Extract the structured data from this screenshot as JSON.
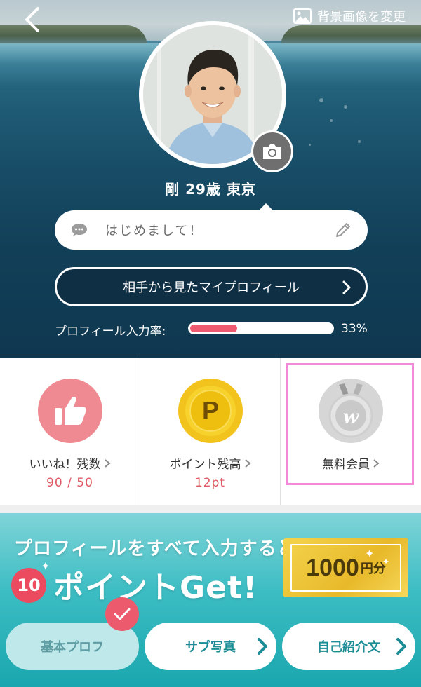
{
  "header": {
    "bg_change_label": "背景画像を変更",
    "user_line": "剛 29歳 東京",
    "greeting": "はじめまして！",
    "my_profile_button": "相手から見たマイプロフィール",
    "completion_label": "プロフィール入力率:",
    "completion_percent": 33,
    "completion_text": "33%"
  },
  "stats": [
    {
      "label": "いいね！残数",
      "value": "90 / 50",
      "icon": "thumbs-up-icon"
    },
    {
      "label": "ポイント残高",
      "value": "12pt",
      "icon": "points-coin-icon"
    },
    {
      "label": "無料会員",
      "value": "",
      "icon": "membership-medal-icon"
    }
  ],
  "banner": {
    "line1": "プロフィールをすべて入力すると",
    "badge_number": "10",
    "line2": "ポイントGet!",
    "gold_amount": "1000",
    "gold_unit": "円分",
    "buttons": [
      "基本プロフ",
      "サブ写真",
      "自己紹介文"
    ]
  },
  "colors": {
    "accent_pink": "#ec5a6e",
    "teal": "#1c8c96",
    "highlight": "#f28ad8"
  }
}
